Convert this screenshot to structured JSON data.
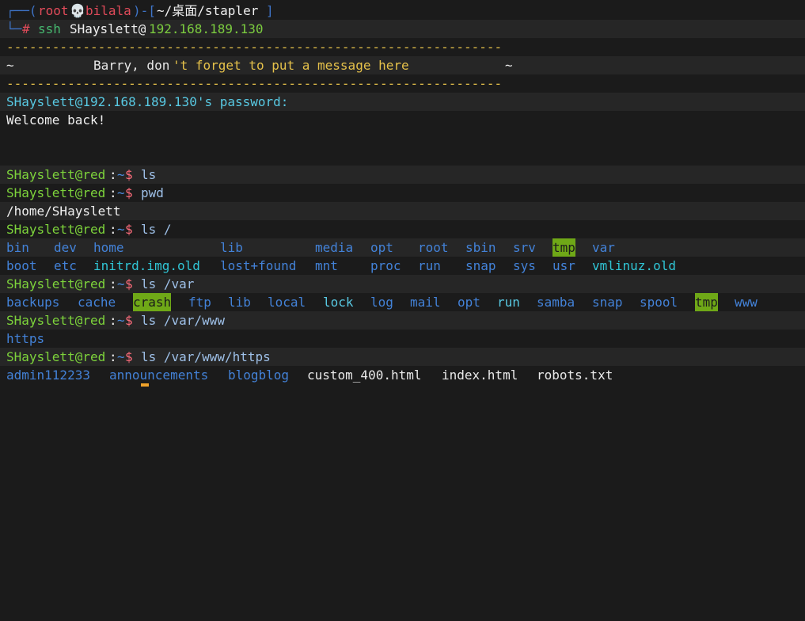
{
  "prompt_user": "root",
  "prompt_skull": "💀",
  "prompt_host": "bilala",
  "prompt_dir": "~/桌面/stapler",
  "prompt_hash": "#",
  "cmd_ssh": "ssh",
  "cmd_target_user": "SHayslett@",
  "cmd_target_ip": "192.168.189.130",
  "banner_dashes": "-----------------------------------------------------------------",
  "banner_tilde_left": "~",
  "banner_msg_a": "Barry, don",
  "banner_msg_b": "'t forget to put a message here",
  "banner_tilde_right": "~",
  "password_prompt": "SHayslett@192.168.189.130's password:",
  "welcome": "Welcome back!",
  "shell_user": "SHayslett@red",
  "shell_sep": ":",
  "shell_path": "~",
  "shell_dollar": "$",
  "cmds": {
    "ls": "ls",
    "pwd": "pwd",
    "ls_root": "ls /",
    "ls_var": "ls /var",
    "ls_www": "ls /var/www",
    "ls_https": "ls /var/www/https"
  },
  "pwd_output": "/home/SHayslett",
  "root_row1": [
    "bin",
    "dev",
    "home",
    "lib",
    "media",
    "opt",
    "root",
    "sbin",
    "srv",
    "tmp",
    "var"
  ],
  "root_row2": [
    "boot",
    "etc",
    "initrd.img.old",
    "lost+found",
    "mnt",
    "proc",
    "run",
    "snap",
    "sys",
    "usr",
    "vmlinuz.old"
  ],
  "var_row": [
    "backups",
    "cache",
    "crash",
    "ftp",
    "lib",
    "local",
    "lock",
    "log",
    "mail",
    "opt",
    "run",
    "samba",
    "snap",
    "spool",
    "tmp",
    "www"
  ],
  "www_row": [
    "https"
  ],
  "https_row": [
    "admin112233",
    "announcements",
    "blogblog",
    "custom_400.html",
    "index.html",
    "robots.txt"
  ]
}
